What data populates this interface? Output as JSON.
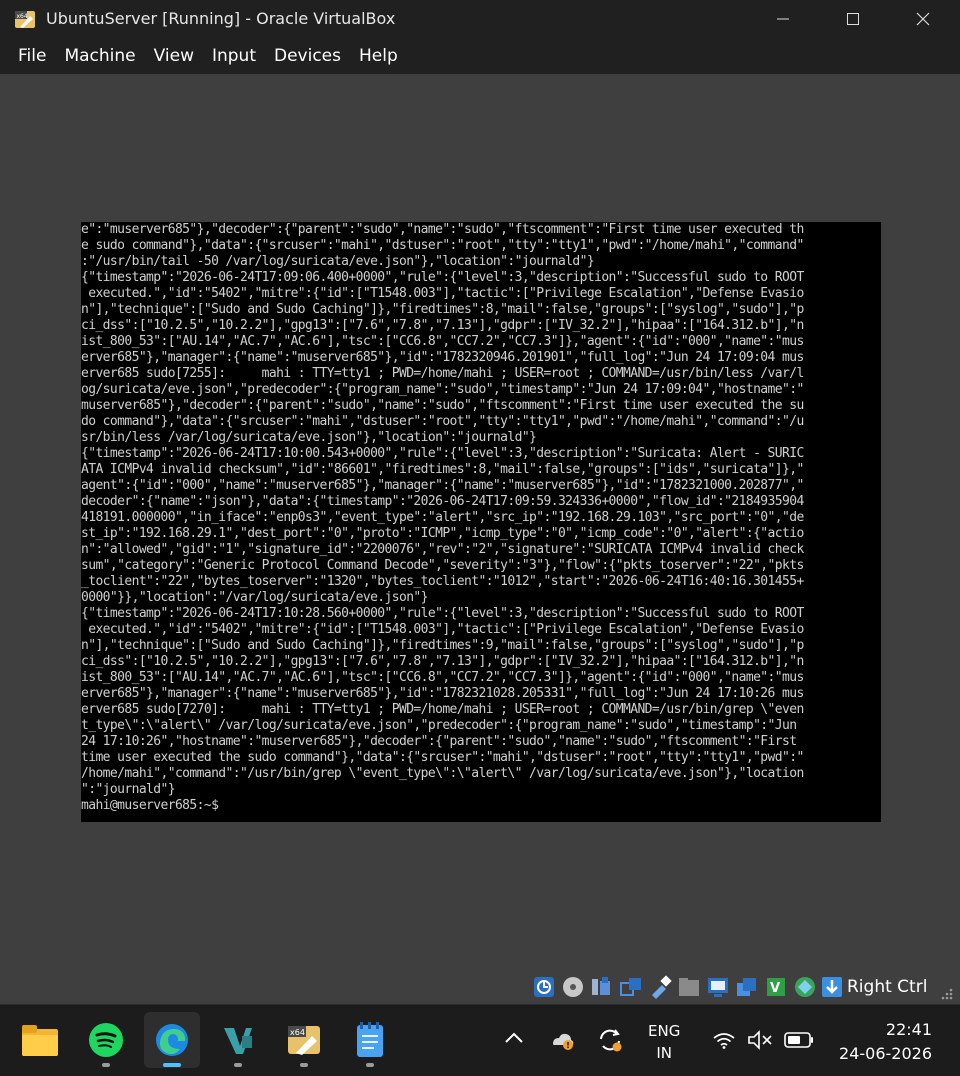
{
  "window": {
    "title": "UbuntuServer [Running] - Oracle VirtualBox",
    "controls": [
      "minimize",
      "maximize",
      "close"
    ]
  },
  "menu": {
    "items": [
      "File",
      "Machine",
      "View",
      "Input",
      "Devices",
      "Help"
    ]
  },
  "console": {
    "lines": [
      "e\":\"muserver685\"},\"decoder\":{\"parent\":\"sudo\",\"name\":\"sudo\",\"ftscomment\":\"First time user executed th",
      "e sudo command\"},\"data\":{\"srcuser\":\"mahi\",\"dstuser\":\"root\",\"tty\":\"tty1\",\"pwd\":\"/home/mahi\",\"command\"",
      ":\"/usr/bin/tail -50 /var/log/suricata/eve.json\"},\"location\":\"journald\"}",
      "{\"timestamp\":\"2026-06-24T17:09:06.400+0000\",\"rule\":{\"level\":3,\"description\":\"Successful sudo to ROOT",
      " executed.\",\"id\":\"5402\",\"mitre\":{\"id\":[\"T1548.003\"],\"tactic\":[\"Privilege Escalation\",\"Defense Evasio",
      "n\"],\"technique\":[\"Sudo and Sudo Caching\"]},\"firedtimes\":8,\"mail\":false,\"groups\":[\"syslog\",\"sudo\"],\"p",
      "ci_dss\":[\"10.2.5\",\"10.2.2\"],\"gpg13\":[\"7.6\",\"7.8\",\"7.13\"],\"gdpr\":[\"IV_32.2\"],\"hipaa\":[\"164.312.b\"],\"n",
      "ist_800_53\":[\"AU.14\",\"AC.7\",\"AC.6\"],\"tsc\":[\"CC6.8\",\"CC7.2\",\"CC7.3\"]},\"agent\":{\"id\":\"000\",\"name\":\"mus",
      "erver685\"},\"manager\":{\"name\":\"muserver685\"},\"id\":\"1782320946.201901\",\"full_log\":\"Jun 24 17:09:04 mus",
      "erver685 sudo[7255]:     mahi : TTY=tty1 ; PWD=/home/mahi ; USER=root ; COMMAND=/usr/bin/less /var/l",
      "og/suricata/eve.json\",\"predecoder\":{\"program_name\":\"sudo\",\"timestamp\":\"Jun 24 17:09:04\",\"hostname\":\"",
      "muserver685\"},\"decoder\":{\"parent\":\"sudo\",\"name\":\"sudo\",\"ftscomment\":\"First time user executed the su",
      "do command\"},\"data\":{\"srcuser\":\"mahi\",\"dstuser\":\"root\",\"tty\":\"tty1\",\"pwd\":\"/home/mahi\",\"command\":\"/u",
      "sr/bin/less /var/log/suricata/eve.json\"},\"location\":\"journald\"}",
      "{\"timestamp\":\"2026-06-24T17:10:00.543+0000\",\"rule\":{\"level\":3,\"description\":\"Suricata: Alert - SURIC",
      "ATA ICMPv4 invalid checksum\",\"id\":\"86601\",\"firedtimes\":8,\"mail\":false,\"groups\":[\"ids\",\"suricata\"]},\"",
      "agent\":{\"id\":\"000\",\"name\":\"muserver685\"},\"manager\":{\"name\":\"muserver685\"},\"id\":\"1782321000.202877\",\"",
      "decoder\":{\"name\":\"json\"},\"data\":{\"timestamp\":\"2026-06-24T17:09:59.324336+0000\",\"flow_id\":\"2184935904",
      "418191.000000\",\"in_iface\":\"enp0s3\",\"event_type\":\"alert\",\"src_ip\":\"192.168.29.103\",\"src_port\":\"0\",\"de",
      "st_ip\":\"192.168.29.1\",\"dest_port\":\"0\",\"proto\":\"ICMP\",\"icmp_type\":\"0\",\"icmp_code\":\"0\",\"alert\":{\"actio",
      "n\":\"allowed\",\"gid\":\"1\",\"signature_id\":\"2200076\",\"rev\":\"2\",\"signature\":\"SURICATA ICMPv4 invalid check",
      "sum\",\"category\":\"Generic Protocol Command Decode\",\"severity\":\"3\"},\"flow\":{\"pkts_toserver\":\"22\",\"pkts",
      "_toclient\":\"22\",\"bytes_toserver\":\"1320\",\"bytes_toclient\":\"1012\",\"start\":\"2026-06-24T16:40:16.301455+",
      "0000\"}},\"location\":\"/var/log/suricata/eve.json\"}",
      "{\"timestamp\":\"2026-06-24T17:10:28.560+0000\",\"rule\":{\"level\":3,\"description\":\"Successful sudo to ROOT",
      " executed.\",\"id\":\"5402\",\"mitre\":{\"id\":[\"T1548.003\"],\"tactic\":[\"Privilege Escalation\",\"Defense Evasio",
      "n\"],\"technique\":[\"Sudo and Sudo Caching\"]},\"firedtimes\":9,\"mail\":false,\"groups\":[\"syslog\",\"sudo\"],\"p",
      "ci_dss\":[\"10.2.5\",\"10.2.2\"],\"gpg13\":[\"7.6\",\"7.8\",\"7.13\"],\"gdpr\":[\"IV_32.2\"],\"hipaa\":[\"164.312.b\"],\"n",
      "ist_800_53\":[\"AU.14\",\"AC.7\",\"AC.6\"],\"tsc\":[\"CC6.8\",\"CC7.2\",\"CC7.3\"]},\"agent\":{\"id\":\"000\",\"name\":\"mus",
      "erver685\"},\"manager\":{\"name\":\"muserver685\"},\"id\":\"1782321028.205331\",\"full_log\":\"Jun 24 17:10:26 mus",
      "erver685 sudo[7270]:     mahi : TTY=tty1 ; PWD=/home/mahi ; USER=root ; COMMAND=/usr/bin/grep \\\"even",
      "t_type\\\":\\\"alert\\\" /var/log/suricata/eve.json\",\"predecoder\":{\"program_name\":\"sudo\",\"timestamp\":\"Jun",
      "24 17:10:26\",\"hostname\":\"muserver685\"},\"decoder\":{\"parent\":\"sudo\",\"name\":\"sudo\",\"ftscomment\":\"First",
      "time user executed the sudo command\"},\"data\":{\"srcuser\":\"mahi\",\"dstuser\":\"root\",\"tty\":\"tty1\",\"pwd\":\"",
      "/home/mahi\",\"command\":\"/usr/bin/grep \\\"event_type\\\":\\\"alert\\\" /var/log/suricata/eve.json\"},\"location",
      "\":\"journald\"}",
      "mahi@muserver685:~$"
    ]
  },
  "statusbar": {
    "icons": [
      "hard-disk-icon",
      "optical-drive-icon",
      "audio-icon",
      "network-icon",
      "usb-icon",
      "shared-folders-icon",
      "display-icon",
      "recording-icon",
      "cpu-icon",
      "mouse-integration-icon",
      "keyboard-icon"
    ],
    "host_key": "Right Ctrl"
  },
  "taskbar": {
    "apps": [
      "file-explorer",
      "spotify",
      "edge",
      "visual-studio",
      "virtualbox",
      "notepad"
    ],
    "language_line1": "ENG",
    "language_line2": "IN",
    "time": "22:41",
    "date": "24-06-2026"
  },
  "colors": {
    "accent": "#4cc2ff",
    "titlebar": "#202020",
    "console_bg": "#000000",
    "console_text": "#cfcfcf"
  }
}
